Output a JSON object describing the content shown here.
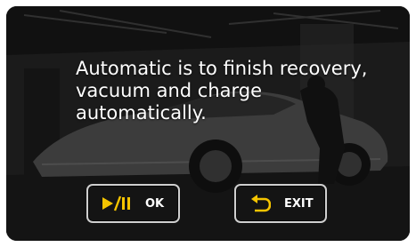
{
  "dialog": {
    "message": "Automatic is to finish  recovery,\nvacuum and charge\nautomatically."
  },
  "buttons": {
    "ok": {
      "label": "OK",
      "icon": "play-pause-icon"
    },
    "exit": {
      "label": "EXIT",
      "icon": "return-arrow-icon"
    }
  },
  "colors": {
    "text": "#ffffff",
    "icon_accent": "#f5c400",
    "button_border": "#cfcfcf"
  }
}
